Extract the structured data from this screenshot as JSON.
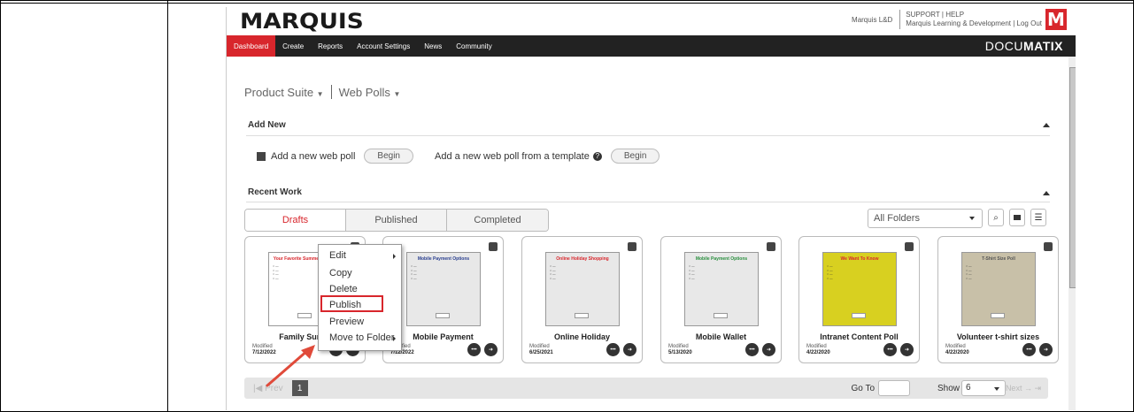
{
  "app": {
    "logo": "MARQUIS",
    "org": "Marquis L&D",
    "support": "SUPPORT | HELP",
    "account": "Marquis Learning & Development | Log Out",
    "mark": "M",
    "product": "DOCUMATIX",
    "product_light": "DOCU",
    "product_bold": "MATIX"
  },
  "nav": [
    "Dashboard",
    "Create",
    "Reports",
    "Account Settings",
    "News",
    "Community"
  ],
  "breadcrumb": {
    "suite": "Product Suite",
    "section": "Web Polls"
  },
  "add_new": {
    "heading": "Add New",
    "new_label": "Add a new web poll",
    "begin": "Begin",
    "template_label": "Add a new web poll from a template"
  },
  "recent": {
    "heading": "Recent Work",
    "tabs": [
      "Drafts",
      "Published",
      "Completed"
    ],
    "folder": "All Folders"
  },
  "cards": [
    {
      "name": "Family Summ",
      "modified": "Modified",
      "date": "7/12/2022",
      "thumb_title": "Your Favorite Summer Activity",
      "thumb_color": "#d8262c",
      "thumb_bg": "#fff"
    },
    {
      "name": "Mobile Payment",
      "modified": "Modified",
      "date": "7/12/2022",
      "thumb_title": "Mobile Payment Options",
      "thumb_color": "#2a3f8f",
      "thumb_bg": "#e8e8e8"
    },
    {
      "name": "Online Holiday",
      "modified": "Modified",
      "date": "6/25/2021",
      "thumb_title": "Online Holiday Shopping",
      "thumb_color": "#d8262c",
      "thumb_bg": "#e8e8e8"
    },
    {
      "name": "Mobile Wallet",
      "modified": "Modified",
      "date": "5/13/2020",
      "thumb_title": "Mobile Payment Options",
      "thumb_color": "#2a8f3f",
      "thumb_bg": "#e8e8e8"
    },
    {
      "name": "Intranet Content Poll",
      "modified": "Modified",
      "date": "4/22/2020",
      "thumb_title": "We Want To Know",
      "thumb_color": "#d8262c",
      "thumb_bg": "#d8d020"
    },
    {
      "name": "Volunteer t-shirt sizes",
      "modified": "Modified",
      "date": "4/22/2020",
      "thumb_title": "T-Shirt Size Poll",
      "thumb_color": "#555",
      "thumb_bg": "#c8c0a8"
    }
  ],
  "context_menu": [
    "Edit",
    "Copy",
    "Delete",
    "Publish",
    "Preview",
    "Move to Folder"
  ],
  "pager": {
    "prev": "Prev",
    "page": "1",
    "goto": "Go To",
    "show": "Show",
    "show_value": "6",
    "next": "Next"
  }
}
